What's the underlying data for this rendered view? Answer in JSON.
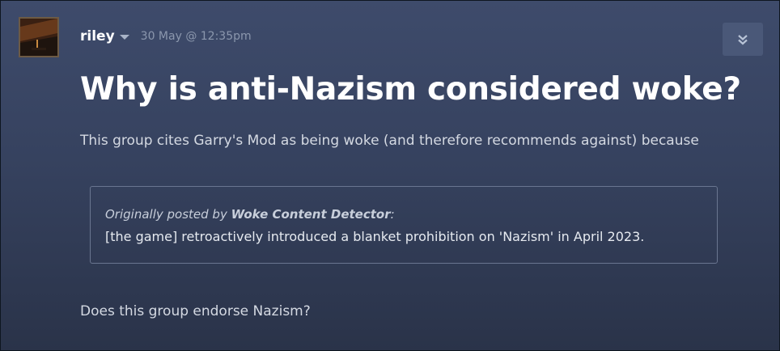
{
  "post": {
    "author": "riley",
    "date": "30 May @ 12:35pm",
    "title": "Why is anti-Nazism considered woke?",
    "body": "This group cites Garry's Mod as being woke (and therefore recommends against) because",
    "quote": {
      "prefix": "Originally posted by",
      "author": "Woke Content Detector",
      "suffix": ":",
      "text": "[the game] retroactively introduced a blanket prohibition on 'Nazism' in April 2023."
    },
    "closing": "Does this group endorse Nazism?"
  },
  "icons": {
    "avatar": "avatar-image",
    "author_menu": "caret-down-icon",
    "collapse": "double-chevron-down-icon"
  },
  "colors": {
    "background_top": "#3e4b6b",
    "background_bottom": "#2a3349",
    "button": "#4a5878",
    "quote_border": "#6a7690"
  }
}
